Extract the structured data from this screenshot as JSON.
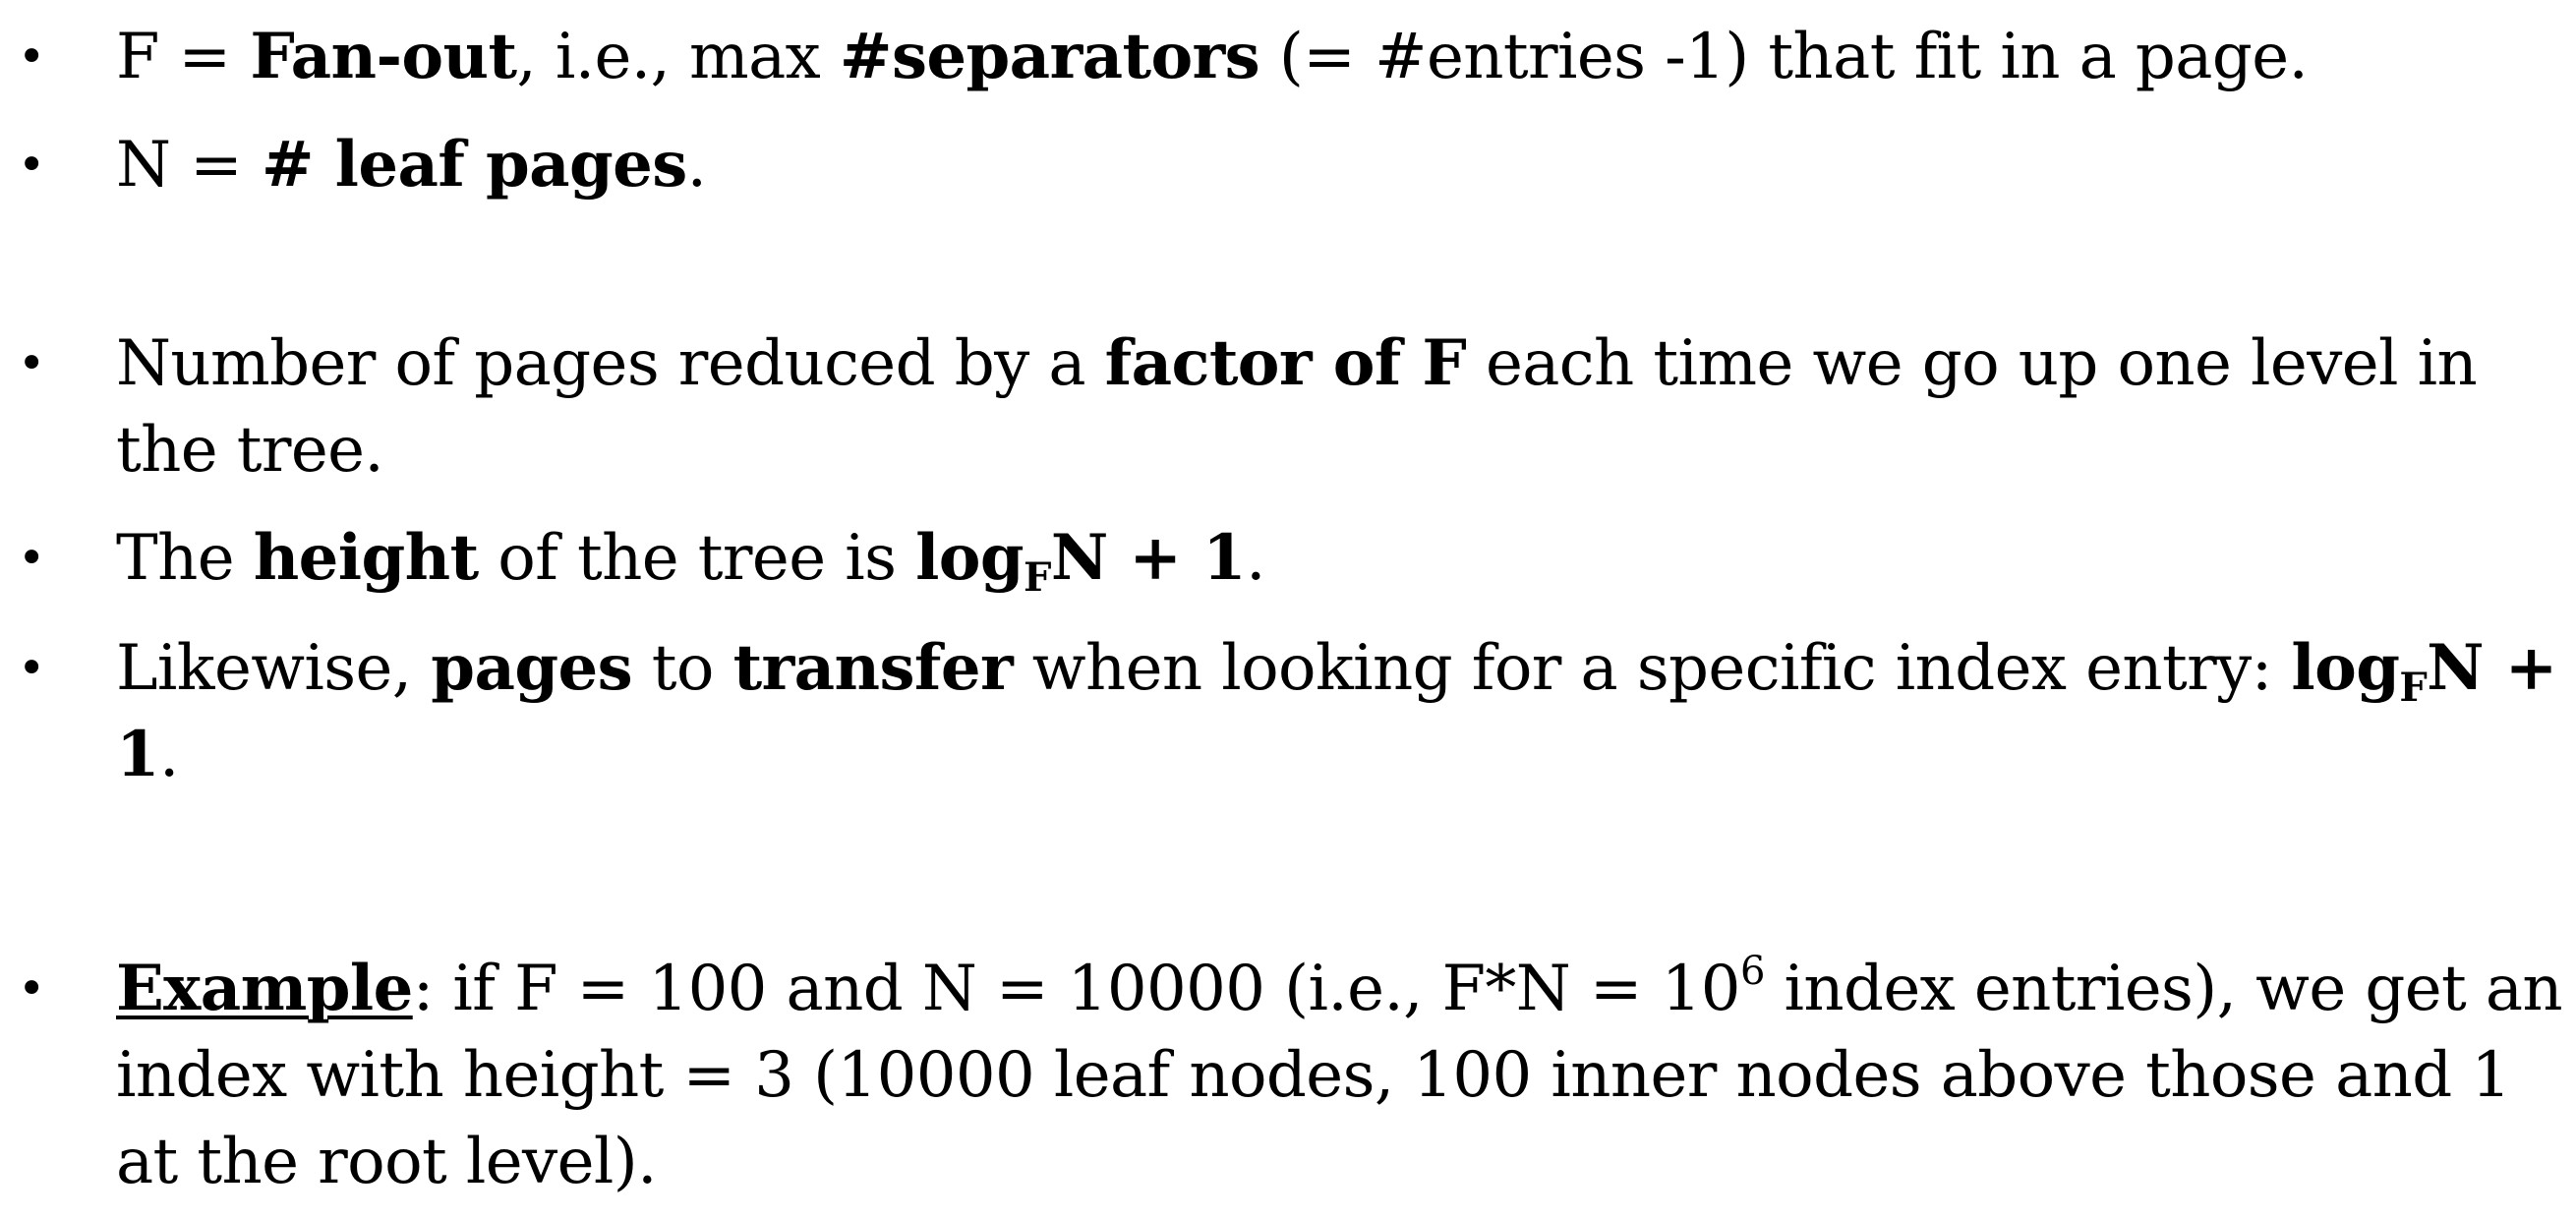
{
  "bullets": [
    {
      "segments": [
        "F = ",
        "Fan-out",
        ", i.e., max ",
        "#separators",
        " (= #entries -1) that fit in a page."
      ]
    },
    {
      "segments": [
        "N = ",
        "# leaf pages",
        "."
      ]
    },
    {
      "line1": [
        "Number of pages reduced by a ",
        "factor of F",
        " each time we go up one level in"
      ],
      "line2": "the tree."
    },
    {
      "segments": [
        "The ",
        "height",
        " of the tree is ",
        "log",
        "F",
        "N + 1",
        "."
      ]
    },
    {
      "line1": [
        "Likewise, ",
        "pages",
        " to ",
        "transfer",
        " when looking for a specific index entry: ",
        "log",
        "F",
        "N +"
      ],
      "line2": [
        "1",
        "."
      ]
    },
    {
      "line1": [
        "Example",
        ": if F = 100 and N = 10000 (i.e., F*N = 10",
        "6",
        " index entries), we get an"
      ],
      "line2": "index with height = 3 (10000 leaf nodes, 100 inner nodes above those and 1",
      "line3": "at the root level)."
    }
  ],
  "bullet_glyph": "•"
}
